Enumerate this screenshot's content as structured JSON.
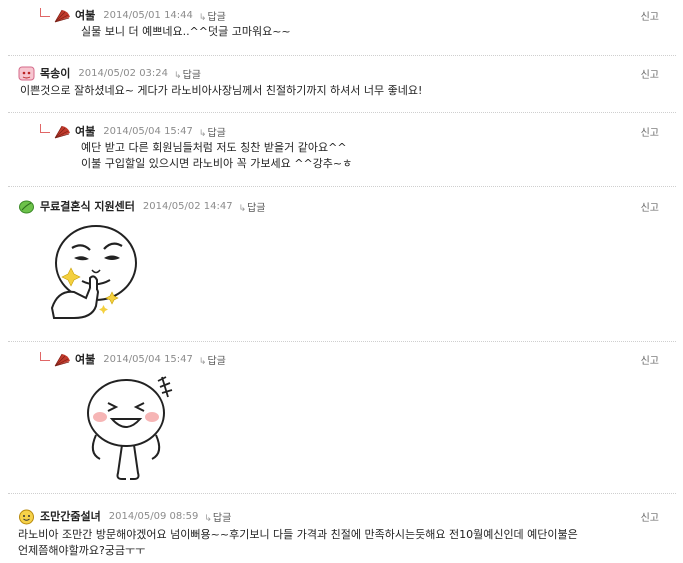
{
  "comments": [
    {
      "nick": "여불",
      "date": "2014/05/01 14:44",
      "reply_label": "답글",
      "report_label": "신고",
      "lines": [
        "실물 보니 더 예쁘네요..^^덧글 고마워요~~"
      ]
    },
    {
      "nick": "목송이",
      "date": "2014/05/02 03:24",
      "reply_label": "답글",
      "report_label": "신고",
      "lines": [
        "이쁜것으로 잘하셨네요~ 게다가 라노비아사장님께서 친절하기까지 하셔서 너무 좋네요!"
      ]
    },
    {
      "nick": "여불",
      "date": "2014/05/04 15:47",
      "reply_label": "답글",
      "report_label": "신고",
      "lines": [
        "예단 받고 다른 회원님들처럼 저도 칭찬 받을거 같아요^^",
        "이불 구입할일 있으시면 라노비아 꼭 가보세요 ^^강추~ㅎ"
      ]
    },
    {
      "nick": "무료결혼식 지원센터",
      "date": "2014/05/02 14:47",
      "reply_label": "답글",
      "report_label": "신고",
      "sticker": "line-moon-thumbs-up-sticker"
    },
    {
      "nick": "여불",
      "date": "2014/05/04 15:47",
      "reply_label": "답글",
      "report_label": "신고",
      "sticker": "line-moon-laughing-sticker"
    },
    {
      "nick": "조만간줌설녀",
      "date": "2014/05/09 08:59",
      "reply_label": "답글",
      "report_label": "신고",
      "lines": [
        "라노비아 조만간 방문해야겠어요 넘이뻐용~~후기보니 다들 가격과 친절에 만족하시는듯해요 전10월예신인데 예단이불은",
        "언제쯤해야할까요?궁금ㅜㅜ"
      ]
    }
  ],
  "icons": {
    "reply_avatar": "red-fan-icon",
    "user2_avatar": "pink-face-icon",
    "user4_avatar": "green-leaf-icon",
    "user6_avatar": "yellow-face-icon"
  },
  "colors": {
    "reply_arrow": "#e06666",
    "date": "#8c8c8c",
    "separator": "#cfcfcf"
  }
}
